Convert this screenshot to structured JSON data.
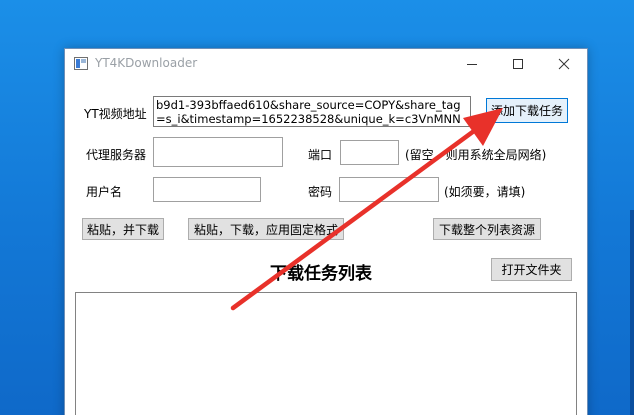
{
  "window": {
    "title": "YT4KDownloader"
  },
  "form": {
    "url_label": "YT视频地址",
    "url_lines": [
      "b9d1-393bffaed610&share_source=COPY&share_tag",
      "=s_i&timestamp=1652238528&unique_k=c3VnMNN"
    ],
    "add_task_button": "添加下载任务",
    "proxy_label": "代理服务器",
    "port_label": "端口",
    "port_hint": "(留空，则用系统全局网络)",
    "username_label": "用户名",
    "password_label": "密码",
    "password_hint": "(如须要，请填)"
  },
  "actions": {
    "paste_download": "粘贴，并下载",
    "paste_download_format": "粘贴，下载，应用固定格式",
    "download_playlist": "下载整个列表资源"
  },
  "task_list": {
    "title": "下载任务列表",
    "open_folder_button": "打开文件夹"
  },
  "colors": {
    "desktop": "#1378d6",
    "arrow": "#e8312a",
    "button_bg": "#e1e1e1"
  }
}
